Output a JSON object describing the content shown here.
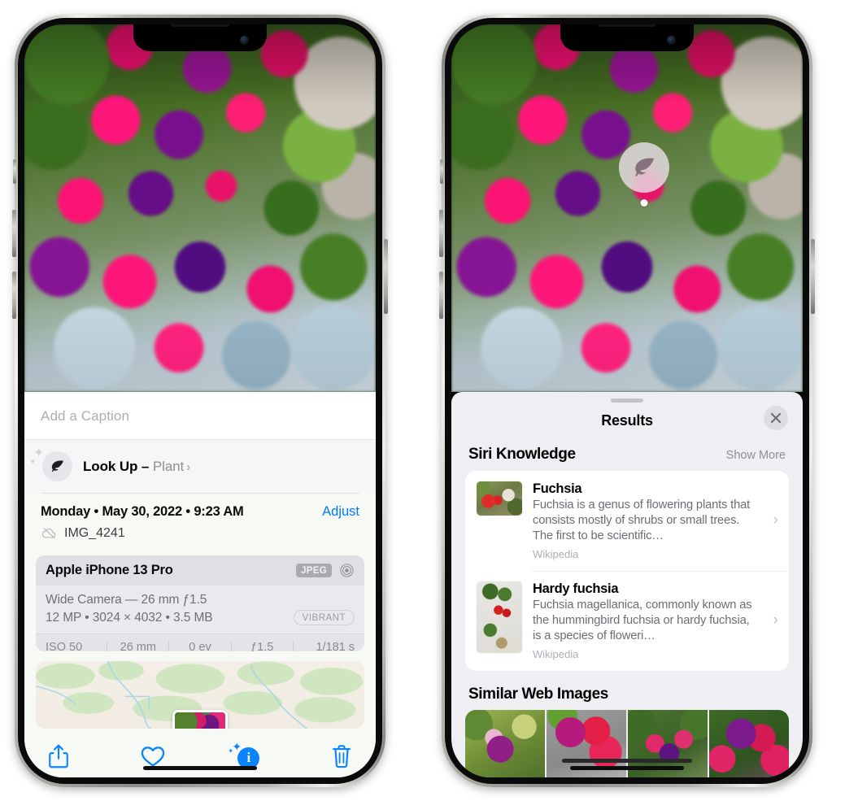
{
  "left_phone": {
    "caption": {
      "placeholder": "Add a Caption",
      "value": ""
    },
    "lookup": {
      "icon": "leaf-icon",
      "label": "Look Up – ",
      "subject": "Plant",
      "chevron": "›"
    },
    "meta": {
      "date": "Monday • May 30, 2022 • 9:23 AM",
      "adjust_label": "Adjust",
      "cloud_icon": "icloud-slash-icon",
      "filename": "IMG_4241"
    },
    "camera_card": {
      "model": "Apple iPhone 13 Pro",
      "format_badge": "JPEG",
      "aperture_icon": "aperture-icon",
      "lens_line": "Wide Camera — 26 mm ƒ1.5",
      "size_line": "12 MP • 3024 × 4032 • 3.5 MB",
      "style_badge": "VIBRANT",
      "exif": [
        "ISO 50",
        "26 mm",
        "0 ev",
        "ƒ1.5",
        "1/181 s"
      ]
    },
    "map": {
      "pin_label": "photo-pin"
    },
    "toolbar": [
      {
        "name": "share-button",
        "icon": "share-icon"
      },
      {
        "name": "favorite-button",
        "icon": "heart-icon"
      },
      {
        "name": "info-button",
        "icon": "info-sparkle-icon"
      },
      {
        "name": "delete-button",
        "icon": "trash-icon"
      }
    ]
  },
  "right_phone": {
    "visual_lookup_badge": {
      "icon": "leaf-icon"
    },
    "sheet": {
      "title": "Results",
      "close_icon": "close-icon",
      "siri_knowledge": {
        "title": "Siri Knowledge",
        "action": "Show More",
        "items": [
          {
            "title": "Fuchsia",
            "description": "Fuchsia is a genus of flowering plants that consists mostly of shrubs or small trees. The first to be scientific…",
            "source": "Wikipedia",
            "thumb": "fuchsia-red-flowers-thumbnail",
            "chevron": "›"
          },
          {
            "title": "Hardy fuchsia",
            "description": "Fuchsia magellanica, commonly known as the hummingbird fuchsia or hardy fuchsia, is a species of floweri…",
            "source": "Wikipedia",
            "thumb": "hardy-fuchsia-specimen-thumbnail",
            "chevron": "›"
          }
        ]
      },
      "similar_web_images": {
        "title": "Similar Web Images",
        "items": [
          {
            "name": "web-image-1"
          },
          {
            "name": "web-image-2"
          },
          {
            "name": "web-image-3"
          },
          {
            "name": "web-image-4"
          }
        ]
      }
    }
  },
  "colors": {
    "accent_blue": "#007AFF",
    "toolbar_blue": "#0A84FF",
    "sheet_bg": "#EEEEF3",
    "card_bg": "#FFFFFF",
    "panel_bg": "#F7F9F4",
    "secondary_text": "#8E8E93"
  }
}
